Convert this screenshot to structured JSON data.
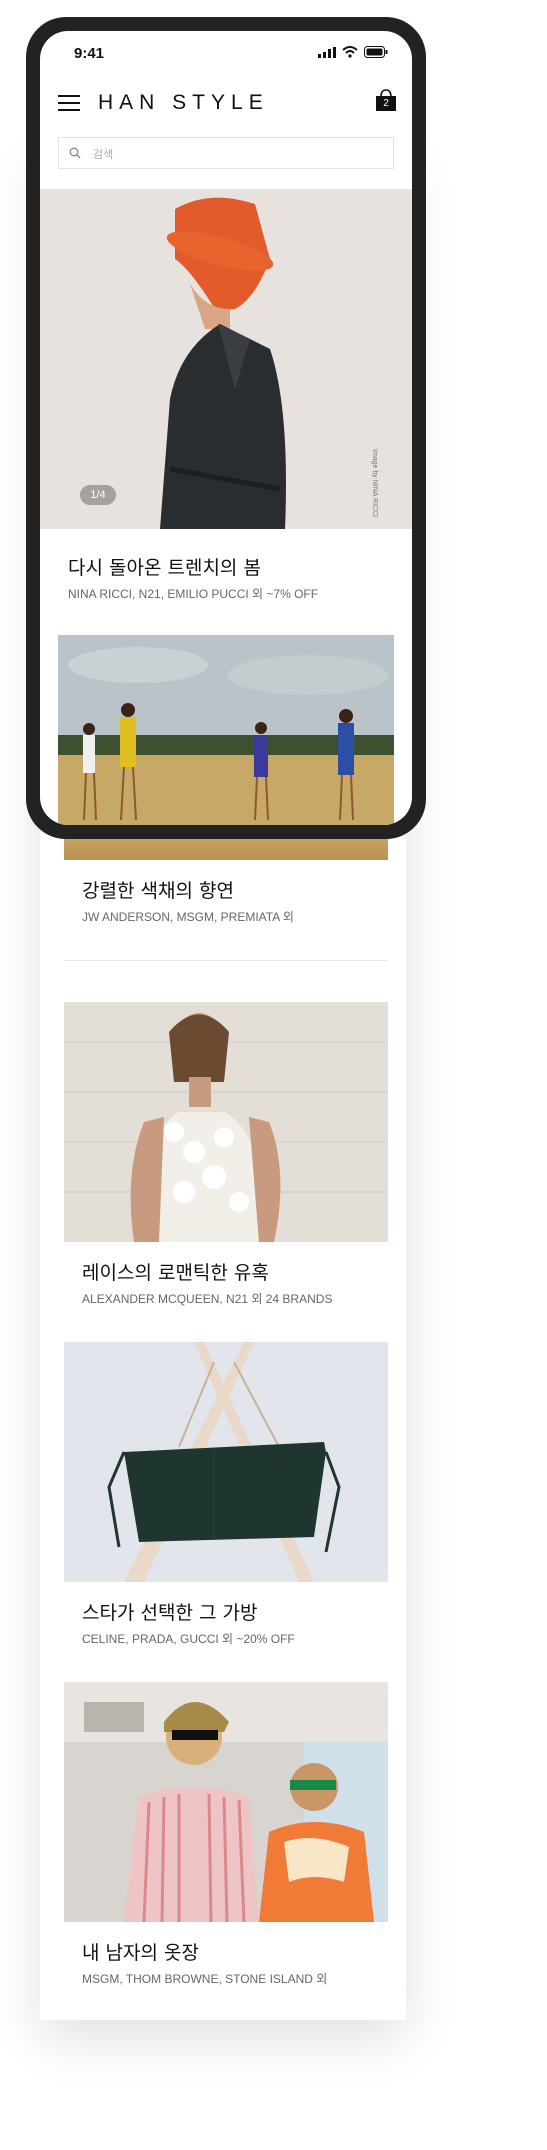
{
  "status": {
    "time": "9:41"
  },
  "header": {
    "logo": "HAN STYLE",
    "cart_count": "2"
  },
  "search": {
    "placeholder": "검색"
  },
  "hero": {
    "pager": "1/4",
    "credit": "Image by NINA RICCI"
  },
  "cards": [
    {
      "title": "다시 돌아온 트렌치의 봄",
      "subtitle": "NINA RICCI, N21, EMILIO PUCCI 외 ~7% OFF"
    },
    {
      "title": "강렬한 색채의 향연",
      "subtitle": "JW ANDERSON, MSGM, PREMIATA 외"
    },
    {
      "title": "레이스의 로맨틱한 유혹",
      "subtitle": "ALEXANDER MCQUEEN, N21 외 24 BRANDS"
    },
    {
      "title": "스타가 선택한 그 가방",
      "subtitle": "CELINE, PRADA, GUCCI 외 ~20% OFF"
    },
    {
      "title": "내 남자의 옷장",
      "subtitle": "MSGM, THOM BROWNE, STONE ISLAND 외"
    }
  ]
}
